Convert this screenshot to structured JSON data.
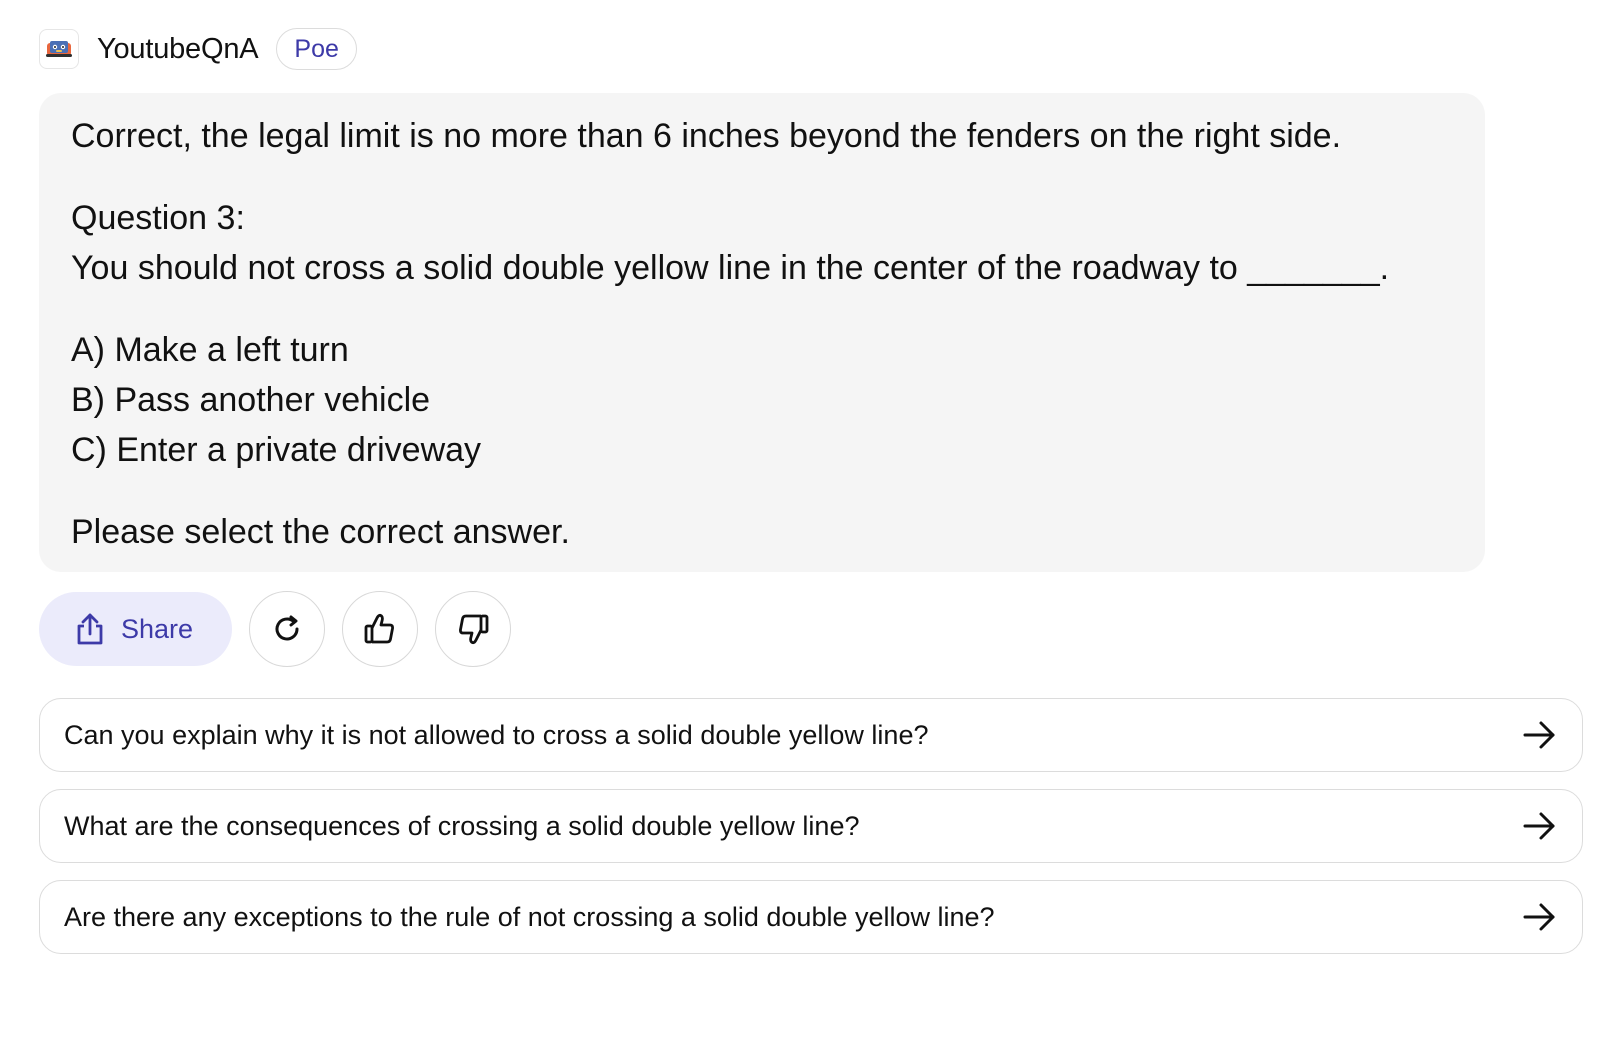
{
  "bot": {
    "name": "YoutubeQnA",
    "badge": "Poe",
    "avatar_icon": "youtube-qna-avatar-icon"
  },
  "message": {
    "line1": "Correct, the legal limit is no more than 6 inches beyond the fenders on the right side.",
    "question_label": "Question 3:",
    "question_text": "You should not cross a solid double yellow line in the center of the roadway to _______.",
    "option_a": "A) Make a left turn",
    "option_b": "B) Pass another vehicle",
    "option_c": "C) Enter a private driveway",
    "prompt": "Please select the correct answer."
  },
  "actions": {
    "share_label": "Share",
    "share_icon": "share-icon",
    "retry_icon": "refresh-icon",
    "like_icon": "thumbs-up-icon",
    "dislike_icon": "thumbs-down-icon"
  },
  "suggestions": [
    "Can you explain why it is not allowed to cross a solid double yellow line?",
    "What are the consequences of crossing a solid double yellow line?",
    "Are there any exceptions to the rule of not crossing a solid double yellow line?"
  ],
  "colors": {
    "accent": "#3d3aa8",
    "share_bg": "#ebebfb",
    "bubble_bg": "#f5f5f5",
    "border": "#dcdcdc"
  }
}
